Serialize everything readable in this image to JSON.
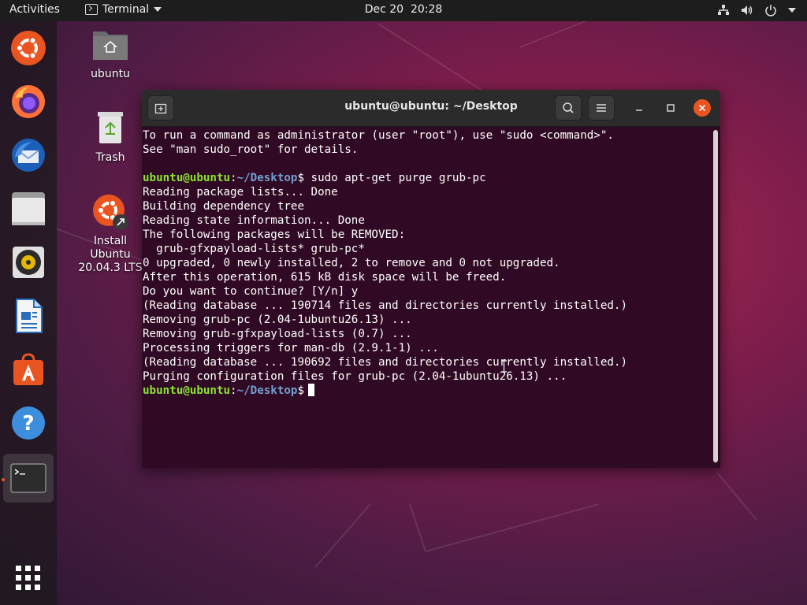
{
  "topbar": {
    "activities": "Activities",
    "app_name": "Terminal",
    "clock": "Dec 20  20:28",
    "icons": [
      "network-icon",
      "volume-icon",
      "power-icon",
      "chevron-down-icon"
    ]
  },
  "dock": {
    "items": [
      {
        "name": "ubuntu-installer-icon",
        "accent": "#e95420"
      },
      {
        "name": "firefox-icon"
      },
      {
        "name": "thunderbird-icon"
      },
      {
        "name": "files-icon"
      },
      {
        "name": "rhythmbox-icon"
      },
      {
        "name": "libreoffice-writer-icon"
      },
      {
        "name": "software-icon"
      },
      {
        "name": "help-icon"
      },
      {
        "name": "terminal-icon"
      }
    ],
    "show_apps_icon": "apps-grid-icon"
  },
  "desktop": {
    "icons": [
      {
        "label": "ubuntu"
      },
      {
        "label": "Trash"
      },
      {
        "label": "Install Ubuntu 20.04.3 LTS",
        "label_line1": "Install Ubuntu",
        "label_line2": "20.04.3 LTS"
      }
    ]
  },
  "terminal": {
    "title": "ubuntu@ubuntu: ~/Desktop",
    "prompt_user": "ubuntu@ubuntu",
    "prompt_sep": ":",
    "prompt_path": "~/Desktop",
    "prompt_end": "$",
    "lines_pre": [
      "To run a command as administrator (user \"root\"), use \"sudo <command>\".",
      "See \"man sudo_root\" for details."
    ],
    "command": " sudo apt-get purge grub-pc",
    "output": [
      "Reading package lists... Done",
      "Building dependency tree",
      "Reading state information... Done",
      "The following packages will be REMOVED:",
      "  grub-gfxpayload-lists* grub-pc*",
      "0 upgraded, 0 newly installed, 2 to remove and 0 not upgraded.",
      "After this operation, 615 kB disk space will be freed.",
      "Do you want to continue? [Y/n] y",
      "(Reading database ... 190714 files and directories currently installed.)",
      "Removing grub-pc (2.04-1ubuntu26.13) ...",
      "Removing grub-gfxpayload-lists (0.7) ...",
      "Processing triggers for man-db (2.9.1-1) ...",
      "(Reading database ... 190692 files and directories currently installed.)",
      "Purging configuration files for grub-pc (2.04-1ubuntu26.13) ..."
    ],
    "colors": {
      "background": "#300a24",
      "user": "#8ae234",
      "path": "#729fcf",
      "close": "#e95420"
    }
  }
}
